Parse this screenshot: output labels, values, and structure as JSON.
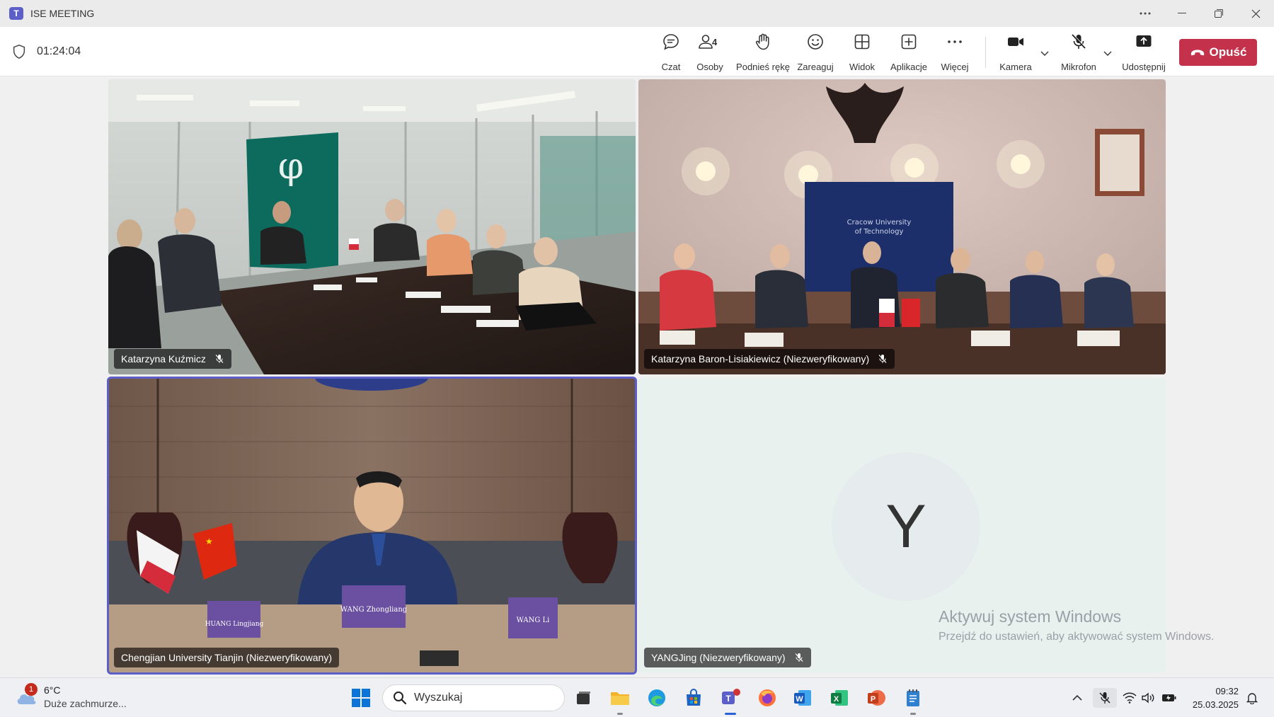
{
  "window": {
    "title": "ISE MEETING",
    "controls": [
      "more-icon",
      "minimize-icon",
      "restore-icon",
      "close-icon"
    ]
  },
  "toolbar": {
    "timer": "01:24:04",
    "buttons": {
      "chat": "Czat",
      "people": "Osoby",
      "people_count": "4",
      "raise_hand": "Podnieś rękę",
      "react": "Zareaguj",
      "view": "Widok",
      "apps": "Aplikacje",
      "more": "Więcej",
      "camera": "Kamera",
      "mic": "Mikrofon",
      "share": "Udostępnij"
    },
    "leave": "Opuść",
    "leave_color": "#c4314b"
  },
  "tiles": [
    {
      "name": "Katarzyna Kuźmicz",
      "muted": true,
      "video": true
    },
    {
      "name": "Katarzyna Baron-Lisiakiewicz (Niezweryfikowany)",
      "muted": true,
      "video": true
    },
    {
      "name": "Chengjian University Tianjin (Niezweryfikowany)",
      "muted": false,
      "video": true,
      "active_speaker": true
    },
    {
      "name": "YANGJing (Niezweryfikowany)",
      "muted": true,
      "video": false,
      "avatar_initial": "Y"
    }
  ],
  "activation": {
    "title": "Aktywuj system Windows",
    "subtitle": "Przejdź do ustawień, aby aktywować system Windows."
  },
  "taskbar": {
    "weather": {
      "badge": "1",
      "temp": "6°C",
      "desc": "Duże zachmurze..."
    },
    "search_placeholder": "Wyszukaj",
    "apps": [
      "windows-start-icon",
      "task-view-icon",
      "file-explorer-icon",
      "edge-icon",
      "store-icon",
      "teams-icon",
      "firefox-icon",
      "word-icon",
      "excel-icon",
      "powerpoint-icon",
      "notepad-icon"
    ],
    "time": "09:32",
    "date": "25.03.2025"
  },
  "colors": {
    "accent": "#5b5fc7",
    "leave": "#c4314b",
    "taskbar": "#eef0f4"
  }
}
